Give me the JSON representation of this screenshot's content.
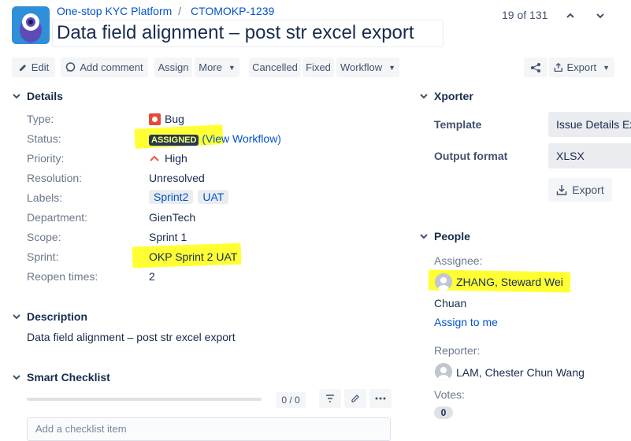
{
  "header": {
    "project_name": "One-stop KYC Platform",
    "issue_key": "CTOMOKP-1239",
    "separator": "/",
    "title": "Data field alignment – post str excel export",
    "pager": "19 of 131"
  },
  "toolbar": {
    "edit": "Edit",
    "add_comment": "Add comment",
    "assign": "Assign",
    "more": "More",
    "cancelled": "Cancelled",
    "fixed": "Fixed",
    "workflow": "Workflow",
    "export": "Export"
  },
  "details": {
    "heading": "Details",
    "type_label": "Type:",
    "type_value": "Bug",
    "status_label": "Status:",
    "status_value": "ASSIGNED",
    "view_workflow": "(View Workflow)",
    "priority_label": "Priority:",
    "priority_value": "High",
    "resolution_label": "Resolution:",
    "resolution_value": "Unresolved",
    "labels_label": "Labels:",
    "labels": [
      "Sprint2",
      "UAT"
    ],
    "department_label": "Department:",
    "department_value": "GienTech",
    "scope_label": "Scope:",
    "scope_value": "Sprint 1",
    "sprint_label": "Sprint:",
    "sprint_value": "OKP Sprint 2 UAT",
    "reopen_label": "Reopen times:",
    "reopen_value": "2"
  },
  "description": {
    "heading": "Description",
    "text": "Data field alignment – post str excel export"
  },
  "checklist": {
    "heading": "Smart Checklist",
    "progress": "0 / 0",
    "progress_fraction": 0,
    "add_placeholder": "Add a checklist item"
  },
  "xporter": {
    "heading": "Xporter",
    "template_label": "Template",
    "template_value": "Issue Details Ex",
    "format_label": "Output format",
    "format_value": "XLSX",
    "export_button": "Export"
  },
  "people": {
    "heading": "People",
    "assignee_label": "Assignee:",
    "assignee_name_line1": "ZHANG, Steward Wei",
    "assignee_name_line2": "Chuan",
    "assign_to_me": "Assign to me",
    "reporter_label": "Reporter:",
    "reporter_name": "LAM, Chester Chun Wang",
    "votes_label": "Votes:",
    "votes_value": "0"
  },
  "colors": {
    "highlight": "#ffff33",
    "link": "#0052cc",
    "bug": "#e5493a",
    "priority_high": "#f15b50"
  }
}
